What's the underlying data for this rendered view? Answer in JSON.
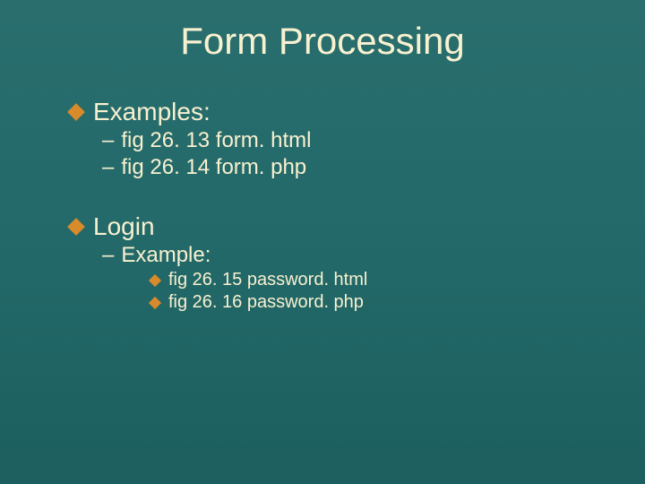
{
  "title": "Form Processing",
  "sections": [
    {
      "heading": "Examples:",
      "items": [
        "fig 26. 13 form. html",
        "fig 26. 14 form. php"
      ]
    },
    {
      "heading": "Login",
      "items": [
        "Example:"
      ],
      "subitems": [
        "fig 26. 15 password. html",
        "fig 26. 16 password. php"
      ]
    }
  ]
}
